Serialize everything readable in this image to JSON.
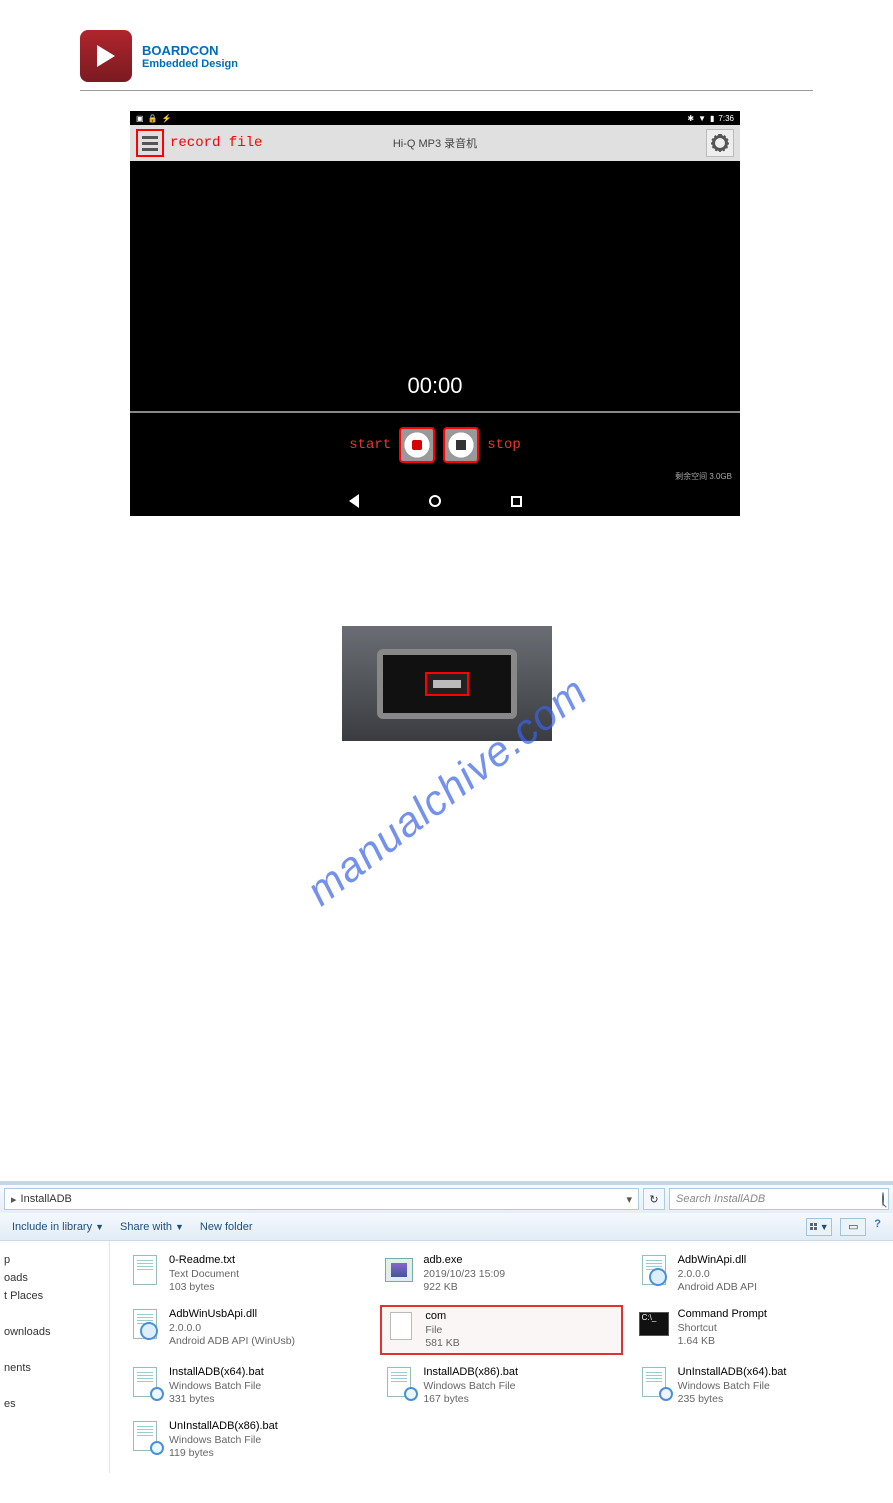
{
  "header": {
    "brand_title": "BOARDCON",
    "brand_sub": "Embedded Design"
  },
  "watermark": "manualchive.com",
  "recorder": {
    "status_time": "7:36",
    "record_file_label": "record file",
    "app_title": "Hi-Q MP3 录音机",
    "timer": "00:00",
    "start_label": "start",
    "stop_label": "stop",
    "storage_text": "剩余空间 3.0GB"
  },
  "explorer": {
    "breadcrumb": "InstallADB",
    "search_placeholder": "Search InstallADB",
    "toolbar": {
      "include": "Include in library",
      "share": "Share with",
      "newfolder": "New folder"
    },
    "sidebar": [
      "p",
      "oads",
      "t Places",
      "",
      "ownloads",
      "",
      "nents",
      "",
      "es"
    ],
    "files": [
      {
        "name": "0-Readme.txt",
        "meta1": "Text Document",
        "meta2": "103 bytes",
        "icon": "doc"
      },
      {
        "name": "adb.exe",
        "meta1": "2019/10/23 15:09",
        "meta2": "922 KB",
        "icon": "exe"
      },
      {
        "name": "AdbWinApi.dll",
        "meta1": "2.0.0.0",
        "meta2": "Android ADB API",
        "icon": "dll"
      },
      {
        "name": "AdbWinUsbApi.dll",
        "meta1": "2.0.0.0",
        "meta2": "Android ADB API (WinUsb)",
        "icon": "dll"
      },
      {
        "name": "com",
        "meta1": "File",
        "meta2": "581 KB",
        "icon": "file",
        "selected": true
      },
      {
        "name": "Command Prompt",
        "meta1": "Shortcut",
        "meta2": "1.64 KB",
        "icon": "cmd"
      },
      {
        "name": "InstallADB(x64).bat",
        "meta1": "Windows Batch File",
        "meta2": "331 bytes",
        "icon": "bat"
      },
      {
        "name": "InstallADB(x86).bat",
        "meta1": "Windows Batch File",
        "meta2": "167 bytes",
        "icon": "bat"
      },
      {
        "name": "UnInstallADB(x64).bat",
        "meta1": "Windows Batch File",
        "meta2": "235 bytes",
        "icon": "bat"
      },
      {
        "name": "UnInstallADB(x86).bat",
        "meta1": "Windows Batch File",
        "meta2": "119 bytes",
        "icon": "bat"
      }
    ]
  }
}
